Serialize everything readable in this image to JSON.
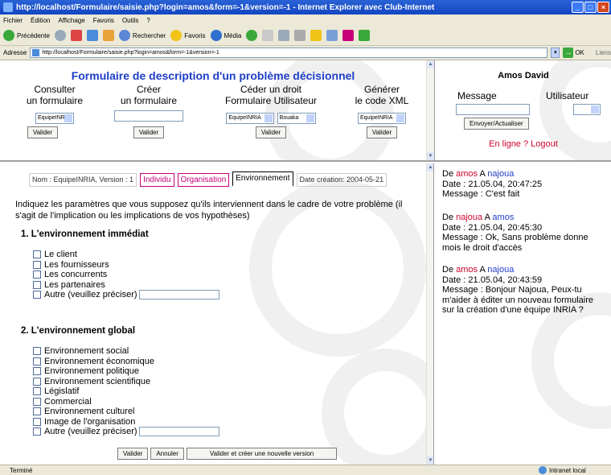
{
  "window": {
    "title": "http://localhost/Formulaire/saisie.php?login=amos&form=-1&version=-1 - Internet Explorer avec Club-Internet"
  },
  "menu": [
    "Fichier",
    "Édition",
    "Affichage",
    "Favoris",
    "Outils",
    "?"
  ],
  "toolbar": {
    "back": "Précédente",
    "search": "Rechercher",
    "favorites": "Favoris",
    "media": "Média"
  },
  "address": {
    "label": "Adresse",
    "url": "http://localhost/Formulaire/saisie.php?login=amos&form=-1&version=-1",
    "go": "OK",
    "links": "Liens"
  },
  "header": {
    "title": "Formulaire de description d'un problème décisionnel",
    "columns": [
      {
        "line1": "Consulter",
        "line2": "un formulaire",
        "select": "EquipeINRIA",
        "button": "Valider"
      },
      {
        "line1": "Créer",
        "line2": "un formulaire",
        "button": "Valider"
      },
      {
        "line1": "Céder un droit",
        "line2": "Formulaire Utilisateur",
        "select": "EquipeINRIA",
        "select2": "Bouaka",
        "button": "Valider"
      },
      {
        "line1": "Générer",
        "line2": "le code XML",
        "select": "EquipeINRIA",
        "button": "Valider"
      }
    ]
  },
  "chat_panel": {
    "user": "Amos David",
    "message_label": "Message",
    "user_label": "Utilisateur",
    "send_button": "Envoyer/Actualiser",
    "online": "En ligne ?",
    "logout": "Logout"
  },
  "tabs": {
    "info": "Nom : EquipeINRIA, Version : 1",
    "individu": "Individu",
    "organisation": "Organisation",
    "environnement": "Environnement",
    "date": "Date création: 2004-05-21"
  },
  "form": {
    "intro": "Indiquez les paramètres que vous supposez qu'ils interviennent dans le cadre de votre problème (il s'agit de l'implication ou les implications de vos hypothèses)",
    "section1": "1.  L'environnement immédiat",
    "section1_items": [
      "Le client",
      "Les fournisseurs",
      "Les concurrents",
      "Les partenaires",
      "Autre (veuillez préciser)"
    ],
    "section2": "2.  L'environnement global",
    "section2_items": [
      "Environnement social",
      "Environnement économique",
      "Environnement politique",
      "Environnement scientifique",
      "Législatif",
      "Commercial",
      "Environnement culturel",
      "Image de l'organisation",
      "Autre (veuillez préciser)"
    ],
    "buttons": {
      "validate": "Valider",
      "cancel": "Annuler",
      "new_version": "Valider et créer une nouvelle version"
    }
  },
  "messages": [
    {
      "de": "De",
      "from": "amos",
      "a": "A",
      "to": "najoua",
      "from_color": "#d2042d",
      "to_color": "#1f3ec8",
      "date": "Date : 21.05.04, 20:47:25",
      "message": "Message : C'est fait"
    },
    {
      "de": "De",
      "from": "najoua",
      "a": "A",
      "to": "amos",
      "from_color": "#d2042d",
      "to_color": "#1f3ec8",
      "date": "Date : 21.05.04, 20:45:30",
      "message": "Message : Ok, Sans problème donne mois le droit d'accès"
    },
    {
      "de": "De",
      "from": "amos",
      "a": "A",
      "to": "najoua",
      "from_color": "#d2042d",
      "to_color": "#1f3ec8",
      "date": "Date : 21.05.04, 20:43:59",
      "message": "Message : Bonjour Najoua, Peux-tu m'aider à éditer un nouveau formulaire sur la création d'une équipe INRIA ?"
    }
  ],
  "status": {
    "left": "Terminé",
    "right": "Intranet local"
  }
}
